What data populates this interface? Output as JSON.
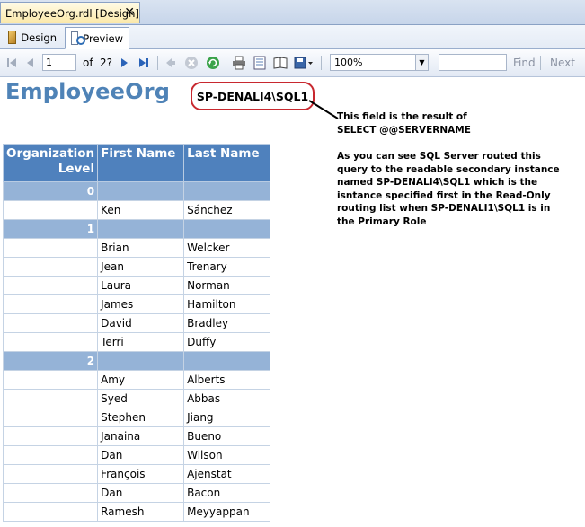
{
  "document_tab": {
    "label": "EmployeeOrg.rdl [Design]",
    "close": "✕"
  },
  "view_tabs": {
    "design": "Design",
    "preview": "Preview"
  },
  "toolbar": {
    "current_page": "1",
    "of_label": "of",
    "total_pages": "2?",
    "zoom": "100%",
    "find_label": "Find",
    "next_label": "Next"
  },
  "report": {
    "title": "EmployeeOrg",
    "server_name": "SP-DENALI4\\SQL1"
  },
  "callout": {
    "line1": "This field is the result of",
    "line2": "SELECT @@SERVERNAME",
    "paragraph": "As you can see SQL Server routed this query to the readable secondary instance named SP-DENALI4\\SQL1 which is the isntance specified first in the Read-Only routing list when SP-DENALI1\\SQL1 is in the Primary Role"
  },
  "table": {
    "headers": {
      "level": "Organization Level",
      "first": "First Name",
      "last": "Last Name"
    },
    "rows": [
      {
        "type": "group",
        "level": "0",
        "first": "",
        "last": ""
      },
      {
        "type": "row",
        "level": "",
        "first": "Ken",
        "last": "Sánchez"
      },
      {
        "type": "group",
        "level": "1",
        "first": "",
        "last": ""
      },
      {
        "type": "row",
        "level": "",
        "first": "Brian",
        "last": "Welcker"
      },
      {
        "type": "row",
        "level": "",
        "first": "Jean",
        "last": "Trenary"
      },
      {
        "type": "row",
        "level": "",
        "first": "Laura",
        "last": "Norman"
      },
      {
        "type": "row",
        "level": "",
        "first": "James",
        "last": "Hamilton"
      },
      {
        "type": "row",
        "level": "",
        "first": "David",
        "last": "Bradley"
      },
      {
        "type": "row",
        "level": "",
        "first": "Terri",
        "last": "Duffy"
      },
      {
        "type": "group",
        "level": "2",
        "first": "",
        "last": ""
      },
      {
        "type": "row",
        "level": "",
        "first": "Amy",
        "last": "Alberts"
      },
      {
        "type": "row",
        "level": "",
        "first": "Syed",
        "last": "Abbas"
      },
      {
        "type": "row",
        "level": "",
        "first": "Stephen",
        "last": "Jiang"
      },
      {
        "type": "row",
        "level": "",
        "first": "Janaina",
        "last": "Bueno"
      },
      {
        "type": "row",
        "level": "",
        "first": "Dan",
        "last": "Wilson"
      },
      {
        "type": "row",
        "level": "",
        "first": "François",
        "last": "Ajenstat"
      },
      {
        "type": "row",
        "level": "",
        "first": "Dan",
        "last": "Bacon"
      },
      {
        "type": "row",
        "level": "",
        "first": "Ramesh",
        "last": "Meyyappan"
      }
    ]
  },
  "icons": {
    "first_page": "first-page-icon",
    "prev_page": "previous-page-icon",
    "next_page": "next-page-icon",
    "last_page": "last-page-icon",
    "back": "back-icon",
    "stop": "stop-icon",
    "refresh": "refresh-icon",
    "print": "print-icon",
    "print_layout": "print-layout-icon",
    "page_setup": "page-setup-icon",
    "export": "export-icon"
  },
  "colors": {
    "title": "#4f83b7",
    "header": "#4f81bd",
    "group_row": "#95b3d7",
    "callout_border": "#c8282f"
  }
}
